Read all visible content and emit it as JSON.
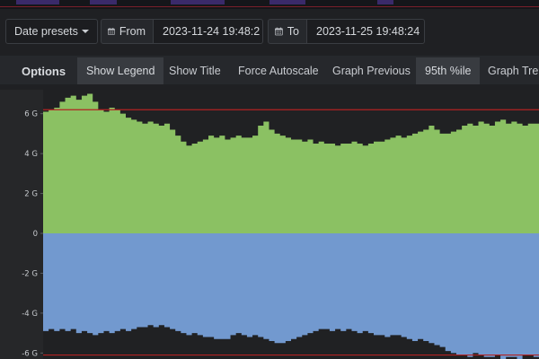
{
  "toolbar": {
    "date_presets_label": "Date presets",
    "from_label": "From",
    "from_value": "2023-11-24 19:48:2",
    "to_label": "To",
    "to_value": "2023-11-25 19:48:24"
  },
  "options": {
    "title": "Options",
    "items": [
      {
        "label": "Show Legend",
        "active": true
      },
      {
        "label": "Show Title",
        "active": false
      },
      {
        "label": "Force Autoscale",
        "active": false
      },
      {
        "label": "Graph Previous",
        "active": false
      },
      {
        "label": "95th %ile",
        "active": true
      },
      {
        "label": "Graph Tren",
        "active": false
      }
    ]
  },
  "chart_data": {
    "type": "area",
    "ylim": [
      -6.3,
      7.2
    ],
    "y_ticks": [
      "6 G",
      "4 G",
      "2 G",
      "0",
      "-2 G",
      "-4 G",
      "-6 G"
    ],
    "y_tick_values": [
      6,
      4,
      2,
      0,
      -2,
      -4,
      -6
    ],
    "threshold_lines": [
      6.2,
      -6.1
    ],
    "colors": {
      "in": "#8bc163",
      "out": "#7299cf",
      "threshold": "#b32222",
      "background": "#202123"
    },
    "series": [
      {
        "values": [
          6.1,
          6.2,
          6.3,
          6.6,
          6.8,
          6.9,
          6.7,
          6.9,
          7.0,
          6.6,
          6.2,
          6.1,
          6.3,
          6.2,
          6.0,
          5.8,
          5.7,
          5.6,
          5.5,
          5.6,
          5.5,
          5.4,
          5.5,
          5.2,
          4.9,
          4.6,
          4.4,
          4.5,
          4.6,
          4.7,
          4.9,
          4.8,
          4.9,
          4.7,
          4.8,
          4.9,
          4.8,
          4.8,
          4.9,
          5.4,
          5.6,
          5.2,
          5.0,
          4.9,
          4.8,
          4.7,
          4.7,
          4.6,
          4.7,
          4.5,
          4.6,
          4.5,
          4.5,
          4.4,
          4.5,
          4.5,
          4.6,
          4.5,
          4.4,
          4.5,
          4.6,
          4.6,
          4.7,
          4.8,
          4.9,
          4.8,
          4.9,
          5.0,
          5.1,
          5.2,
          5.4,
          5.2,
          5.0,
          5.0,
          5.1,
          5.2,
          5.4,
          5.5,
          5.4,
          5.6,
          5.5,
          5.4,
          5.6,
          5.7,
          5.5,
          5.6,
          5.5,
          5.4,
          5.5,
          5.5
        ]
      },
      {
        "values": [
          -4.9,
          -4.8,
          -4.9,
          -4.8,
          -4.9,
          -4.8,
          -5.0,
          -4.9,
          -5.0,
          -5.1,
          -5.0,
          -4.9,
          -5.0,
          -4.9,
          -4.8,
          -4.9,
          -4.8,
          -4.7,
          -4.7,
          -4.6,
          -4.7,
          -4.6,
          -4.7,
          -4.8,
          -4.9,
          -5.0,
          -5.1,
          -5.0,
          -5.1,
          -5.2,
          -5.2,
          -5.3,
          -5.3,
          -5.3,
          -5.1,
          -5.0,
          -5.1,
          -5.2,
          -5.1,
          -5.2,
          -5.3,
          -5.4,
          -5.5,
          -5.5,
          -5.4,
          -5.3,
          -5.2,
          -5.1,
          -5.0,
          -4.9,
          -4.8,
          -4.8,
          -4.9,
          -4.8,
          -4.9,
          -4.8,
          -4.9,
          -5.0,
          -4.9,
          -5.0,
          -5.1,
          -5.1,
          -5.2,
          -5.1,
          -5.1,
          -5.2,
          -5.3,
          -5.4,
          -5.3,
          -5.4,
          -5.5,
          -5.6,
          -5.7,
          -5.9,
          -6.0,
          -6.1,
          -6.1,
          -6.2,
          -6.0,
          -6.1,
          -6.2,
          -6.2,
          -6.1,
          -6.3,
          -6.2,
          -6.2,
          -6.3,
          -6.1,
          -6.1,
          -6.2
        ]
      }
    ]
  }
}
